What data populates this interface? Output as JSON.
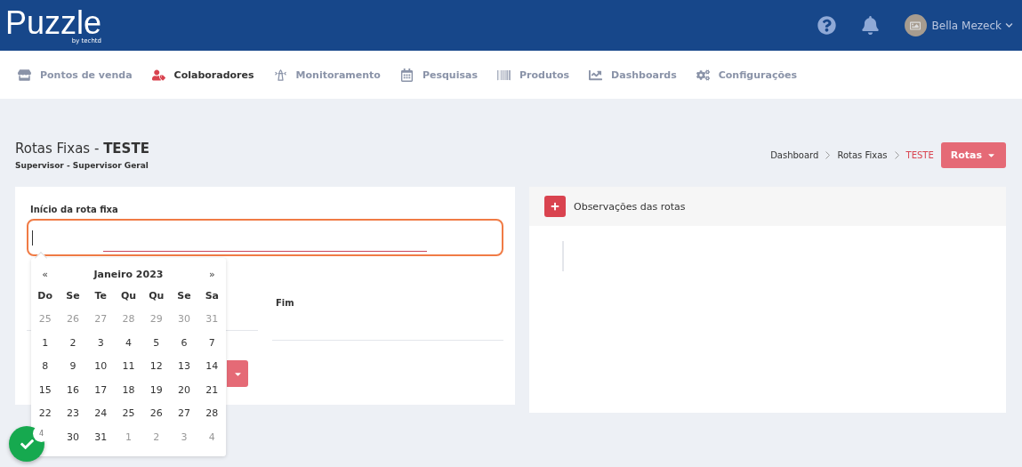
{
  "brand": {
    "name": "Puzzle",
    "tagline": "by techtd"
  },
  "user": {
    "name": "Bella Mezeck"
  },
  "nav": [
    {
      "label": "Pontos de venda",
      "selected": false
    },
    {
      "label": "Colaboradores",
      "selected": true
    },
    {
      "label": "Monitoramento",
      "selected": false
    },
    {
      "label": "Pesquisas",
      "selected": false
    },
    {
      "label": "Produtos",
      "selected": false
    },
    {
      "label": "Dashboards",
      "selected": false
    },
    {
      "label": "Configurações",
      "selected": false
    }
  ],
  "page": {
    "title": "Rotas Fixas - **TESTE**",
    "subtitle": "Supervisor - Supervisor Geral"
  },
  "breadcrumb": [
    {
      "label": "Dashboard",
      "selected": false
    },
    {
      "label": "Rotas Fixas",
      "selected": false
    },
    {
      "label": "TESTE",
      "selected": true
    }
  ],
  "rotas_button": "Rotas",
  "form": {
    "start_label": "Início da rota fixa",
    "end_label": "Fim"
  },
  "calendar": {
    "prev": "«",
    "next": "»",
    "month": "Janeiro 2023",
    "weekdays": [
      "Do",
      "Se",
      "Te",
      "Qu",
      "Qu",
      "Se",
      "Sa"
    ],
    "weeks": [
      [
        {
          "day": "25",
          "muted": true
        },
        {
          "day": "26",
          "muted": true
        },
        {
          "day": "27",
          "muted": true
        },
        {
          "day": "28",
          "muted": true
        },
        {
          "day": "29",
          "muted": true
        },
        {
          "day": "30",
          "muted": true
        },
        {
          "day": "31",
          "muted": true
        }
      ],
      [
        {
          "day": "1",
          "muted": false
        },
        {
          "day": "2",
          "muted": false
        },
        {
          "day": "3",
          "muted": false
        },
        {
          "day": "4",
          "muted": false
        },
        {
          "day": "5",
          "muted": false
        },
        {
          "day": "6",
          "muted": false
        },
        {
          "day": "7",
          "muted": false
        }
      ],
      [
        {
          "day": "8",
          "muted": false
        },
        {
          "day": "9",
          "muted": false
        },
        {
          "day": "10",
          "muted": false
        },
        {
          "day": "11",
          "muted": false
        },
        {
          "day": "12",
          "muted": false
        },
        {
          "day": "13",
          "muted": false
        },
        {
          "day": "14",
          "muted": false
        }
      ],
      [
        {
          "day": "15",
          "muted": false
        },
        {
          "day": "16",
          "muted": false
        },
        {
          "day": "17",
          "muted": false
        },
        {
          "day": "18",
          "muted": false
        },
        {
          "day": "19",
          "muted": false
        },
        {
          "day": "20",
          "muted": false
        },
        {
          "day": "21",
          "muted": false
        }
      ],
      [
        {
          "day": "22",
          "muted": false
        },
        {
          "day": "23",
          "muted": false
        },
        {
          "day": "24",
          "muted": false
        },
        {
          "day": "25",
          "muted": false
        },
        {
          "day": "26",
          "muted": false
        },
        {
          "day": "27",
          "muted": false
        },
        {
          "day": "28",
          "muted": false
        }
      ],
      [
        {
          "day": "30",
          "muted": false
        },
        {
          "day": "31",
          "muted": false
        },
        {
          "day": "1",
          "muted": true
        },
        {
          "day": "2",
          "muted": true
        },
        {
          "day": "3",
          "muted": true
        },
        {
          "day": "4",
          "muted": true
        }
      ]
    ]
  },
  "notes": {
    "title": "Observações das rotas"
  },
  "fab": {
    "badge": "4"
  }
}
